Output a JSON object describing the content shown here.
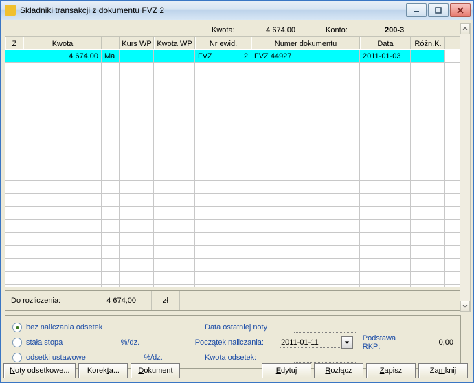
{
  "title": "Składniki transakcji z dokumentu FVZ  2",
  "info": {
    "kwota_label": "Kwota:",
    "kwota_value": "4 674,00",
    "konto_label": "Konto:",
    "konto_value": "200-3"
  },
  "headers": {
    "z": "Z",
    "kwota": "Kwota",
    "kurs": "Kurs WP",
    "kwotawp": "Kwota WP",
    "nrewid": "Nr ewid.",
    "numdok": "Numer dokumentu",
    "data": "Data",
    "roznk": "Różn.K."
  },
  "rows": [
    {
      "z": "",
      "kwota": "4 674,00",
      "side": "Ma",
      "kurs": "",
      "kwp": "",
      "nrew_a": "FVZ",
      "nrew_b": "2",
      "numd": "FVZ 44927",
      "data": "2011-01-03",
      "rk": ""
    }
  ],
  "summary": {
    "label": "Do rozliczenia:",
    "value": "4 674,00",
    "unit": "zł"
  },
  "options": {
    "opt1": "bez naliczania odsetek",
    "opt2": "stała stopa",
    "opt3": "odsetki ustawowe",
    "rate_suffix": "%/dz.",
    "last_note": "Data ostatniej noty",
    "start": "Początek naliczania:",
    "start_val": "2011-01-11",
    "amount": "Kwota odsetek:",
    "basis": "Podstawa RKP:",
    "basis_val": "0,00"
  },
  "buttons": {
    "noty_pre": "N",
    "noty_post": "oty odsetkowe...",
    "kor_pre": "Korek",
    "kor_u": "t",
    "kor_post": "a...",
    "dok_pre": "",
    "dok_u": "D",
    "dok_post": "okument",
    "edy_pre": "",
    "edy_u": "E",
    "edy_post": "dytuj",
    "roz_pre": "",
    "roz_u": "R",
    "roz_post": "ozłącz",
    "zap_pre": "",
    "zap_u": "Z",
    "zap_post": "apisz",
    "zam_pre": "Za",
    "zam_u": "m",
    "zam_post": "knij"
  }
}
